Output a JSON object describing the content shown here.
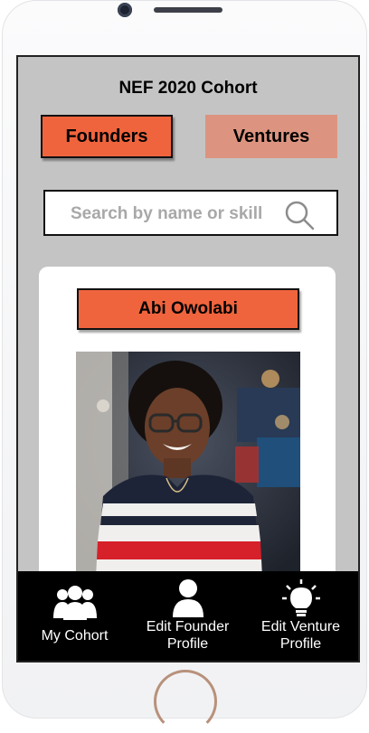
{
  "header": {
    "title": "NEF 2020 Cohort"
  },
  "tabs": {
    "founders_label": "Founders",
    "ventures_label": "Ventures"
  },
  "search": {
    "placeholder": "Search by name or skill",
    "icon": "search-icon"
  },
  "profile": {
    "name": "Abi Owolabi"
  },
  "navbar": {
    "items": [
      {
        "label": "My Cohort",
        "icon": "group-icon"
      },
      {
        "label_line1": "Edit Founder",
        "label_line2": "Profile",
        "icon": "person-icon"
      },
      {
        "label_line1": "Edit Venture",
        "label_line2": "Profile",
        "icon": "lightbulb-icon"
      }
    ]
  },
  "colors": {
    "accent": "#f0643d",
    "accent_muted": "#dc9480",
    "screen_bg": "#c4c4c4",
    "navbar_bg": "#000000"
  }
}
